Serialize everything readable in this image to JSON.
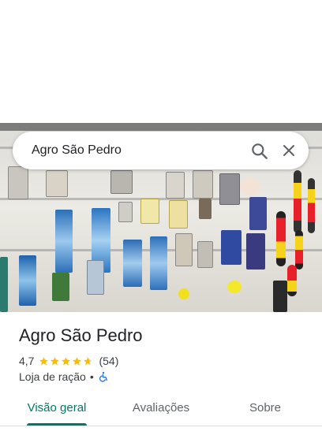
{
  "search": {
    "query": "Agro São Pedro"
  },
  "icons": {
    "search": "search-icon",
    "close": "close-icon",
    "star": "star-icon",
    "wheelchair": "wheelchair-accessible-icon"
  },
  "photo": {
    "subject": "fishing-tackle-wall-photo"
  },
  "place": {
    "name": "Agro São Pedro",
    "rating": "4,7",
    "rating_stars": 4.7,
    "review_count": "(54)",
    "category": "Loja de ração",
    "separator": "•"
  },
  "tabs": [
    {
      "label": "Visão geral",
      "active": true
    },
    {
      "label": "Avaliações",
      "active": false
    },
    {
      "label": "Sobre",
      "active": false
    }
  ],
  "colors": {
    "accent": "#00796b",
    "star": "#fbbc04",
    "star_empty": "#dadce0",
    "wheelchair": "#1a73e8",
    "text_primary": "#202124",
    "text_secondary": "#3c4043",
    "tab_inactive": "#5f6368"
  }
}
